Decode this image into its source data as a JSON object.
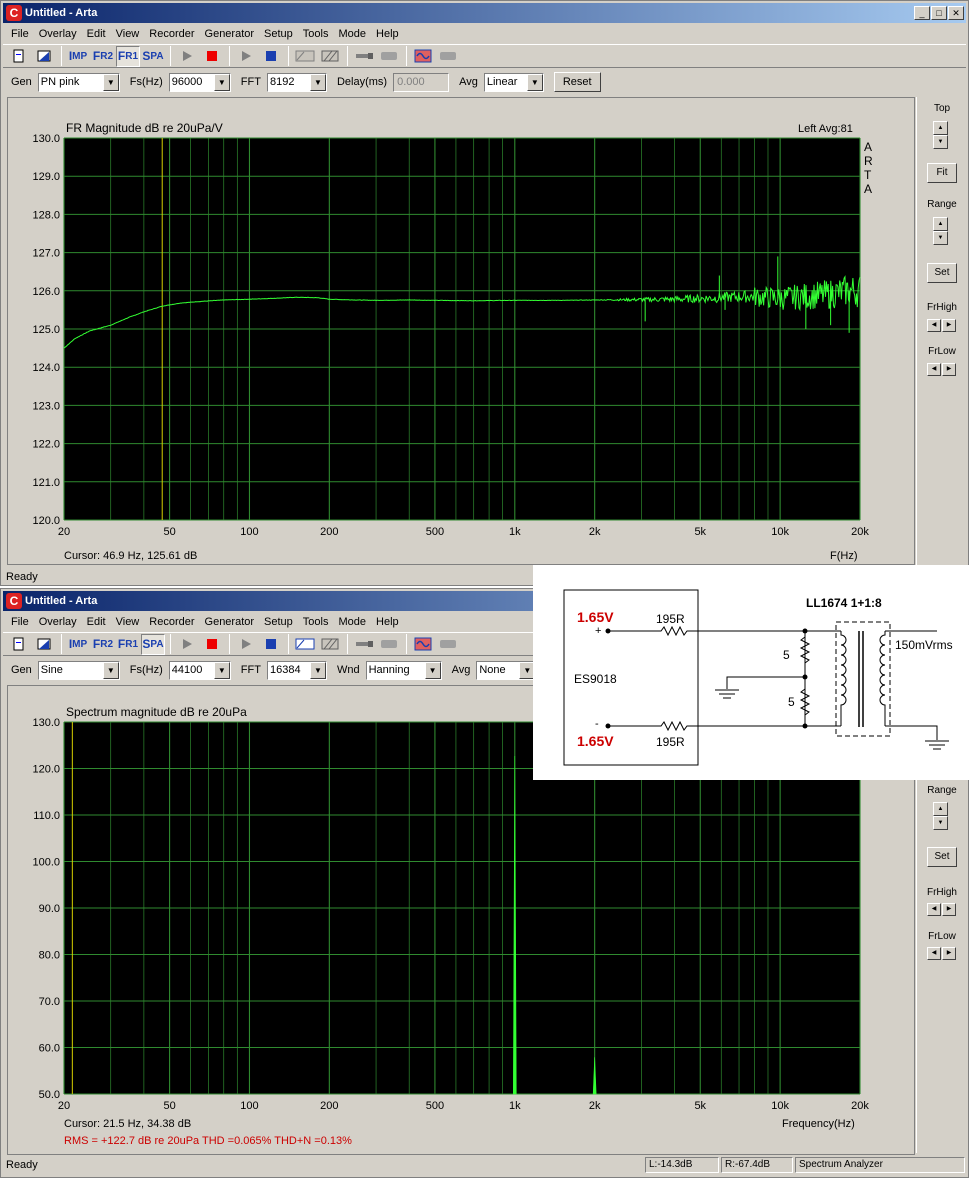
{
  "windows": [
    {
      "title": "Untitled - Arta",
      "menu": [
        "File",
        "Overlay",
        "Edit",
        "View",
        "Recorder",
        "Generator",
        "Setup",
        "Tools",
        "Mode",
        "Help"
      ],
      "params": [
        {
          "label": "Gen",
          "value": "PN pink",
          "w": 82
        },
        {
          "label": "Fs(Hz)",
          "value": "96000",
          "w": 62
        },
        {
          "label": "FFT",
          "value": "8192",
          "w": 60
        }
      ],
      "delay_label": "Delay(ms)",
      "delay_value": "0.000",
      "avg_label": "Avg",
      "avg_value": "Linear",
      "reset_label": "Reset",
      "graph_title": "FR Magnitude dB re 20uPa/V",
      "graph_right": "Left  Avg:81",
      "arta_vertical": "A R T A",
      "cursor_text": "Cursor:   46.9 Hz, 125.61 dB",
      "xaxis_label": "F(Hz)",
      "status": "Ready",
      "sidebar": {
        "top": "Top",
        "fit": "Fit",
        "range": "Range",
        "set": "Set",
        "frhigh": "FrHigh",
        "frlow": "FrLow"
      }
    },
    {
      "title": "Untitled - Arta",
      "menu": [
        "File",
        "Overlay",
        "Edit",
        "View",
        "Recorder",
        "Generator",
        "Setup",
        "Tools",
        "Mode",
        "Help"
      ],
      "params": [
        {
          "label": "Gen",
          "value": "Sine",
          "w": 82
        },
        {
          "label": "Fs(Hz)",
          "value": "44100",
          "w": 62
        },
        {
          "label": "FFT",
          "value": "16384",
          "w": 60
        },
        {
          "label": "Wnd",
          "value": "Hanning",
          "w": 76
        }
      ],
      "avg_label": "Avg",
      "avg_value": "None",
      "graph_title": "Spectrum magnitude dB re 20uPa",
      "cursor_text": "Cursor:   21.5 Hz, 34.38 dB",
      "xaxis_label": "Frequency(Hz)",
      "rms_text": "RMS = +122.7 dB re 20uPa    THD =0.065%    THD+N =0.13%",
      "status": "Ready",
      "status_boxes": [
        "L:-14.3dB",
        "R:-67.4dB",
        "Spectrum Analyzer"
      ],
      "sidebar": {
        "range": "Range",
        "set": "Set",
        "frhigh": "FrHigh",
        "frlow": "FrLow"
      }
    }
  ],
  "chart_data": [
    {
      "type": "line",
      "title": "FR Magnitude dB re 20uPa/V",
      "xlabel": "F(Hz)",
      "xscale": "log",
      "xlim": [
        20,
        20000
      ],
      "ylim": [
        120,
        130
      ],
      "x_ticks": [
        "20",
        "50",
        "100",
        "200",
        "500",
        "1k",
        "2k",
        "5k",
        "10k",
        "20k"
      ],
      "y_ticks": [
        "130.0",
        "129.0",
        "128.0",
        "127.0",
        "126.0",
        "125.0",
        "124.0",
        "123.0",
        "122.0",
        "121.0",
        "120.0"
      ],
      "cursor_x": 46.9,
      "series": [
        {
          "x": [
            20,
            22,
            25,
            30,
            35,
            40,
            47,
            55,
            65,
            80,
            100,
            120,
            150,
            180,
            200,
            250,
            300,
            400,
            500,
            700,
            1000,
            1500,
            2000,
            3000,
            4000,
            5000,
            6000,
            7000,
            8000,
            10000,
            12000,
            15000,
            18000,
            20000
          ],
          "y": [
            124.5,
            124.75,
            124.95,
            125.1,
            125.3,
            125.45,
            125.6,
            125.68,
            125.72,
            125.76,
            125.78,
            125.8,
            125.83,
            125.82,
            125.78,
            125.76,
            125.75,
            125.76,
            125.75,
            125.74,
            125.75,
            125.75,
            125.76,
            125.77,
            125.78,
            125.8,
            125.82,
            125.85,
            125.85,
            125.8,
            125.85,
            125.9,
            126.0,
            126.0
          ]
        }
      ],
      "spikes": [
        [
          3100,
          125.2
        ],
        [
          5900,
          126.4
        ],
        [
          6200,
          125.5
        ],
        [
          9800,
          126.9
        ],
        [
          12500,
          125.0
        ],
        [
          15500,
          125.1
        ],
        [
          18200,
          124.9
        ]
      ]
    },
    {
      "type": "line",
      "title": "Spectrum magnitude dB re 20uPa",
      "xlabel": "Frequency(Hz)",
      "xscale": "log",
      "xlim": [
        20,
        20000
      ],
      "ylim": [
        50,
        130
      ],
      "x_ticks": [
        "20",
        "50",
        "100",
        "200",
        "500",
        "1k",
        "2k",
        "5k",
        "10k",
        "20k"
      ],
      "y_ticks": [
        "130.0",
        "120.0",
        "110.0",
        "100.0",
        "90.0",
        "80.0",
        "70.0",
        "60.0",
        "50.0"
      ],
      "cursor_x": 21.5,
      "peaks": [
        [
          1000,
          122.7
        ],
        [
          2000,
          57.9
        ]
      ]
    }
  ],
  "schematic": {
    "v_top": "1.65V",
    "v_bot": "1.65V",
    "plus": "+",
    "minus": "-",
    "r_top": "195R",
    "r_bot": "195R",
    "chip": "ES9018",
    "r5a": "5",
    "r5b": "5",
    "transformer": "LL1674   1+1:8",
    "out": "150mVrms",
    "red": "#cc0000"
  }
}
